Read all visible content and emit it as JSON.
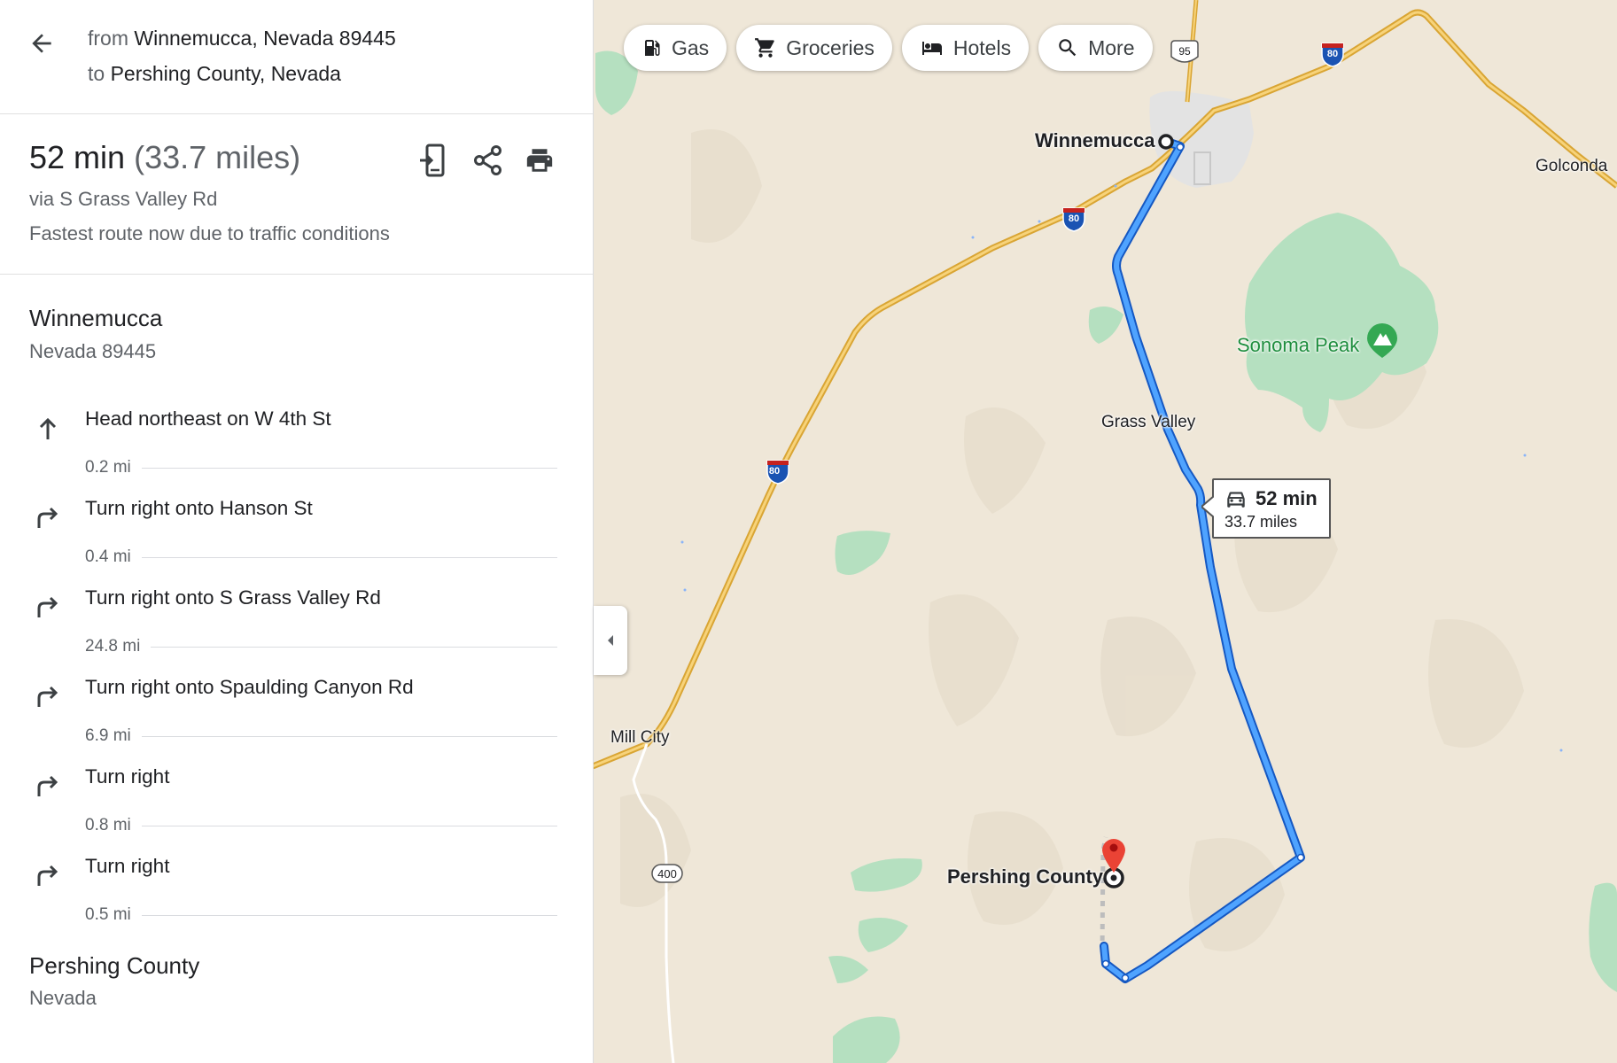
{
  "directions": {
    "from_prefix": "from",
    "from_place": "Winnemucca, Nevada 89445",
    "to_prefix": "to",
    "to_place": "Pershing County, Nevada"
  },
  "route": {
    "duration": "52 min",
    "distance": "(33.7 miles)",
    "via": "via S Grass Valley Rd",
    "note": "Fastest route now due to traffic conditions"
  },
  "start": {
    "name": "Winnemucca",
    "sub": "Nevada 89445"
  },
  "steps": [
    {
      "instruction": "Head northeast on W 4th St",
      "distance": "0.2 mi",
      "icon": "arrow-up-icon"
    },
    {
      "instruction": "Turn right onto Hanson St",
      "distance": "0.4 mi",
      "icon": "turn-right-icon"
    },
    {
      "instruction": "Turn right onto S Grass Valley Rd",
      "distance": "24.8 mi",
      "icon": "turn-right-icon"
    },
    {
      "instruction": "Turn right onto Spaulding Canyon Rd",
      "distance": "6.9 mi",
      "icon": "turn-right-icon"
    },
    {
      "instruction": "Turn right",
      "distance": "0.8 mi",
      "icon": "turn-right-icon"
    },
    {
      "instruction": "Turn right",
      "distance": "0.5 mi",
      "icon": "turn-right-icon"
    }
  ],
  "end": {
    "name": "Pershing County",
    "sub": "Nevada"
  },
  "chips": [
    {
      "label": "Gas",
      "icon": "gas-station-icon"
    },
    {
      "label": "Groceries",
      "icon": "shopping-cart-icon"
    },
    {
      "label": "Hotels",
      "icon": "bed-icon"
    },
    {
      "label": "More",
      "icon": "search-icon"
    }
  ],
  "map": {
    "labels": {
      "winnemucca": "Winnemucca",
      "golconda": "Golconda",
      "sonoma_peak": "Sonoma Peak",
      "grass_valley": "Grass Valley",
      "mill_city": "Mill City",
      "pershing_county": "Pershing County"
    },
    "shields": {
      "i80": "80",
      "us95": "95",
      "sr400": "400"
    },
    "callout": {
      "time": "52 min",
      "miles": "33.7 miles"
    }
  },
  "colors": {
    "route_blue": "#1a73e8",
    "route_light": "#4fa3ff",
    "highway_yellow": "#f3c04a",
    "terrain_green": "#b5e0c0",
    "land_beige": "#efe7d8",
    "pin_red": "#ea4335"
  }
}
